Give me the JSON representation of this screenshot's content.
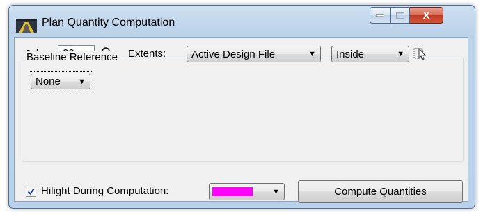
{
  "window": {
    "title": "Plan Quantity Computation",
    "icon": "roadway-app-icon",
    "controls": {
      "minimize": "minimize-icon",
      "maximize": "maximize-icon",
      "close": "X"
    }
  },
  "job": {
    "label": "Job:",
    "value": "00",
    "lookup_icon": "magnifier-icon"
  },
  "extents": {
    "label": "Extents:",
    "source": "Active Design File",
    "mode": "Inside",
    "select_icon": "selection-cursor-icon"
  },
  "baseline": {
    "group_label": "Baseline Reference",
    "value": "None"
  },
  "highlight": {
    "checkbox_checked": true,
    "label": "Hilight During Computation:",
    "color": "#ff00ff"
  },
  "actions": {
    "compute_label": "Compute Quantities"
  },
  "colors": {
    "close_button": "#c84a33",
    "highlight_swatch": "#ff00ff",
    "check_mark": "#1a3e8c"
  }
}
